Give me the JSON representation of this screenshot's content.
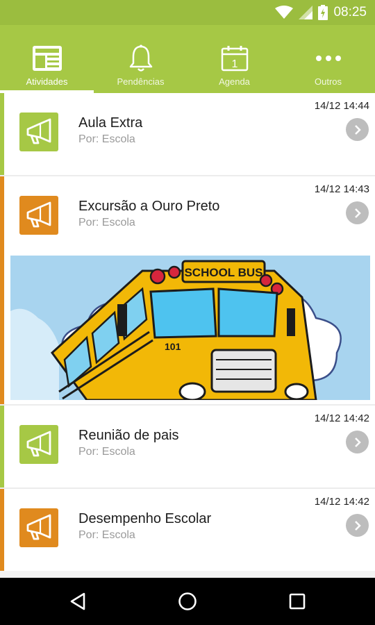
{
  "status_bar": {
    "time": "08:25",
    "icons": [
      "wifi-icon",
      "signal-icon",
      "battery-icon"
    ]
  },
  "tabs": [
    {
      "label": "Atividades",
      "icon": "newspaper-icon",
      "selected": true
    },
    {
      "label": "Pendências",
      "icon": "bell-icon",
      "selected": false
    },
    {
      "label": "Agenda",
      "icon": "calendar-icon",
      "selected": false
    },
    {
      "label": "Outros",
      "icon": "more-dots-icon",
      "selected": false
    }
  ],
  "calendar_day": "1",
  "activities": [
    {
      "title": "Aula Extra",
      "author": "Por: Escola",
      "timestamp": "14/12 14:44",
      "color": "#a6c845",
      "icon": "megaphone-icon"
    },
    {
      "title": "Excursão a Ouro Preto",
      "author": "Por: Escola",
      "timestamp": "14/12 14:43",
      "color": "#e08a1e",
      "icon": "megaphone-icon",
      "image": {
        "sign": "SCHOOL BUS",
        "number": "101"
      }
    },
    {
      "title": "Reunião de pais",
      "author": "Por: Escola",
      "timestamp": "14/12 14:42",
      "color": "#a6c845",
      "icon": "megaphone-icon"
    },
    {
      "title": "Desempenho Escolar",
      "author": "Por: Escola",
      "timestamp": "14/12 14:42",
      "color": "#e08a1e",
      "icon": "megaphone-icon"
    }
  ],
  "colors": {
    "header": "#a6c845",
    "status": "#9bbd3f",
    "green": "#a6c845",
    "orange": "#e08a1e"
  },
  "nav_bar": [
    "back-icon",
    "home-icon",
    "recents-icon"
  ]
}
